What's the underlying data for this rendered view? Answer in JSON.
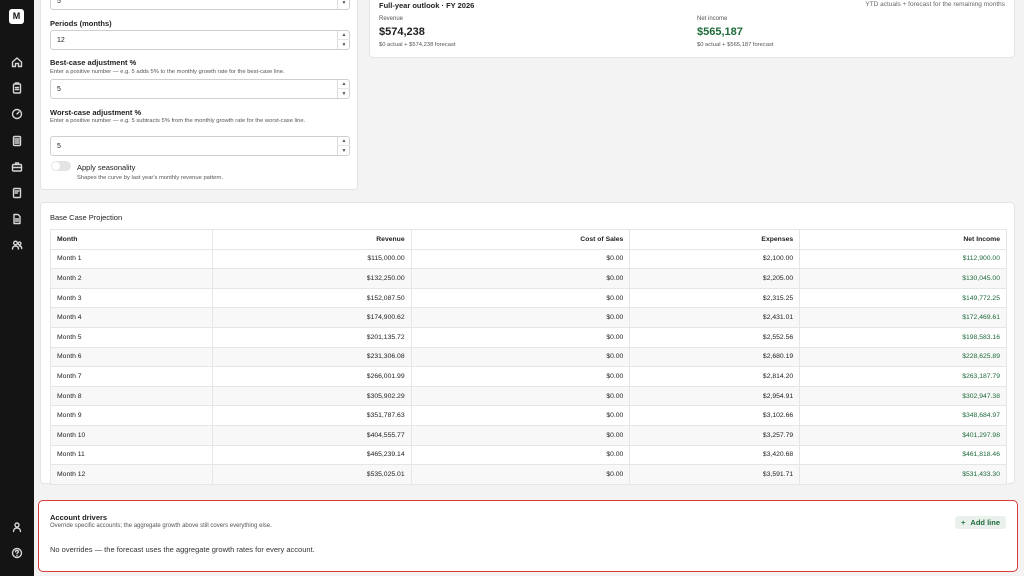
{
  "params": {
    "top_value": "5",
    "periods": {
      "label": "Periods (months)",
      "value": "12"
    },
    "best_case": {
      "label": "Best-case adjustment %",
      "help": "Enter a positive number — e.g. 5 adds 5% to the monthly growth rate for the best-case line.",
      "value": "5"
    },
    "worst_case": {
      "label": "Worst-case adjustment %",
      "help": "Enter a positive number — e.g. 5 subtracts 5% from the monthly growth rate for the worst-case line.",
      "value": "5"
    },
    "seasonality": {
      "label": "Apply seasonality",
      "help": "Shapes the curve by last year's monthly revenue pattern.",
      "enabled": false
    }
  },
  "outlook": {
    "title": "Full-year outlook · FY 2026",
    "note": "YTD actuals + forecast for the remaining months",
    "revenue": {
      "label": "Revenue",
      "value": "$574,238",
      "sub": "$0 actual + $574,238 forecast"
    },
    "net_income": {
      "label": "Net income",
      "value": "$565,187",
      "sub": "$0 actual + $565,187 forecast"
    }
  },
  "projection": {
    "title": "Base Case Projection",
    "columns": [
      "Month",
      "Revenue",
      "Cost of Sales",
      "Expenses",
      "Net Income"
    ],
    "rows": [
      [
        "Month 1",
        "$115,000.00",
        "$0.00",
        "$2,100.00",
        "$112,900.00"
      ],
      [
        "Month 2",
        "$132,250.00",
        "$0.00",
        "$2,205.00",
        "$130,045.00"
      ],
      [
        "Month 3",
        "$152,087.50",
        "$0.00",
        "$2,315.25",
        "$149,772.25"
      ],
      [
        "Month 4",
        "$174,900.62",
        "$0.00",
        "$2,431.01",
        "$172,469.61"
      ],
      [
        "Month 5",
        "$201,135.72",
        "$0.00",
        "$2,552.56",
        "$198,583.16"
      ],
      [
        "Month 6",
        "$231,306.08",
        "$0.00",
        "$2,680.19",
        "$228,625.89"
      ],
      [
        "Month 7",
        "$266,001.99",
        "$0.00",
        "$2,814.20",
        "$263,187.79"
      ],
      [
        "Month 8",
        "$305,902.29",
        "$0.00",
        "$2,954.91",
        "$302,947.38"
      ],
      [
        "Month 9",
        "$351,787.63",
        "$0.00",
        "$3,102.66",
        "$348,684.97"
      ],
      [
        "Month 10",
        "$404,555.77",
        "$0.00",
        "$3,257.79",
        "$401,297.98"
      ],
      [
        "Month 11",
        "$465,239.14",
        "$0.00",
        "$3,420.68",
        "$461,818.46"
      ],
      [
        "Month 12",
        "$535,025.01",
        "$0.00",
        "$3,591.71",
        "$531,433.30"
      ]
    ]
  },
  "drivers": {
    "title": "Account drivers",
    "subtitle": "Override specific accounts; the aggregate growth above still covers everything else.",
    "empty": "No overrides — the forecast uses the aggregate growth rates for every account.",
    "add_label": "Add line",
    "add_icon": "+"
  },
  "sidebar": {
    "logo": "M",
    "icons": [
      "home-icon",
      "clipboard-icon",
      "gauge-icon",
      "ledger-icon",
      "briefcase-icon",
      "report-icon",
      "document-icon",
      "users-icon",
      "user-icon",
      "help-icon"
    ]
  },
  "colors": {
    "accent_green": "#1e6b3a",
    "highlight_border": "#d93a3a",
    "sidebar_bg": "#141414"
  }
}
